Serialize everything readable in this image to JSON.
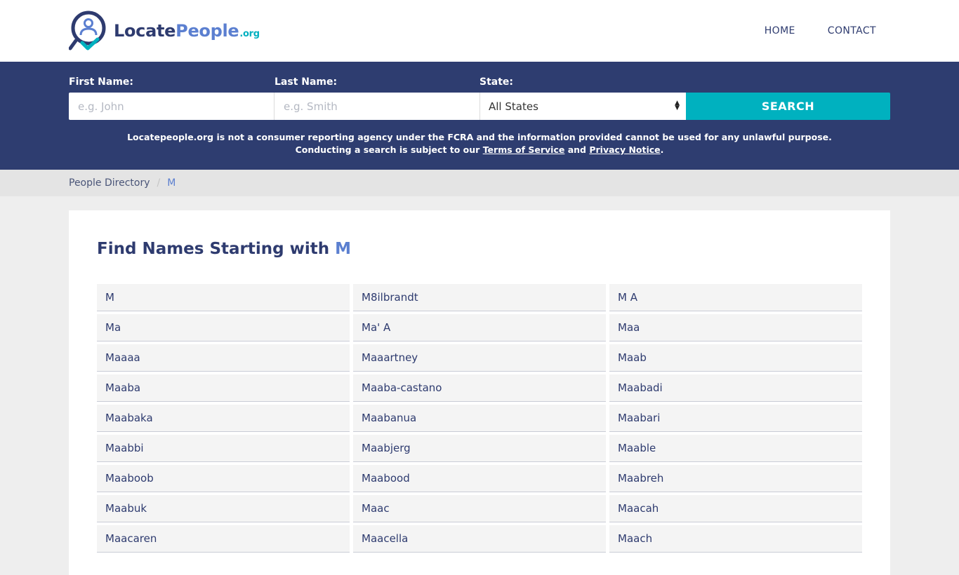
{
  "header": {
    "logo": {
      "locate": "Locate",
      "people": "People",
      "org": ".org"
    },
    "nav": [
      {
        "label": "HOME"
      },
      {
        "label": "CONTACT"
      }
    ]
  },
  "search": {
    "first_label": "First Name:",
    "first_placeholder": "e.g. John",
    "last_label": "Last Name:",
    "last_placeholder": "e.g. Smith",
    "state_label": "State:",
    "state_value": "All States",
    "button": "SEARCH",
    "disclaimer_line1": "Locatepeople.org is not a consumer reporting agency under the FCRA and the information provided cannot be used for any unlawful purpose.",
    "disclaimer_line2_pre": "Conducting a search is subject to our ",
    "terms_link": "Terms of Service",
    "disclaimer_and": " and ",
    "privacy_link": "Privacy Notice",
    "disclaimer_end": "."
  },
  "breadcrumb": {
    "root": "People Directory",
    "separator": "/",
    "current": "M"
  },
  "main": {
    "heading_prefix": "Find Names Starting with ",
    "heading_letter": "M",
    "names": [
      "M",
      "M8ilbrandt",
      "M A",
      "Ma",
      "Ma' A",
      "Maa",
      "Maaaa",
      "Maaartney",
      "Maab",
      "Maaba",
      "Maaba-castano",
      "Maabadi",
      "Maabaka",
      "Maabanua",
      "Maabari",
      "Maabbi",
      "Maabjerg",
      "Maable",
      "Maaboob",
      "Maabood",
      "Maabreh",
      "Maabuk",
      "Maac",
      "Maacah",
      "Maacaren",
      "Maacella",
      "Maach"
    ]
  },
  "colors": {
    "navy": "#2e3d70",
    "accent_blue": "#5b7fd0",
    "teal": "#00b1bf"
  }
}
